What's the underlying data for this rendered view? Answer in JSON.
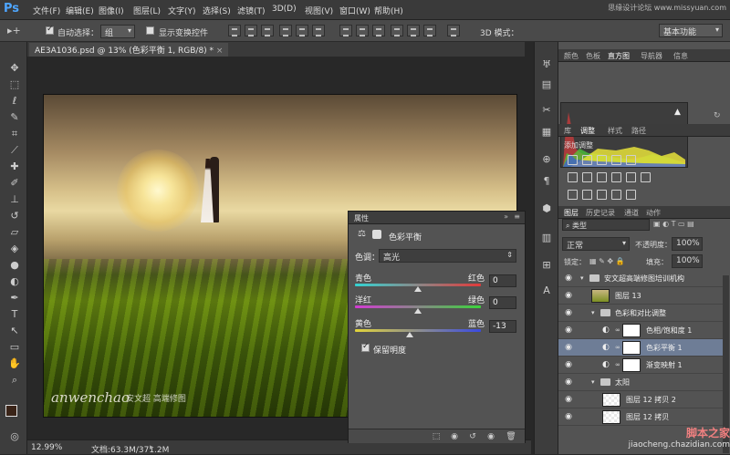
{
  "app": {
    "logo": "Ps"
  },
  "menu": {
    "items": [
      "文件(F)",
      "编辑(E)",
      "图像(I)",
      "图层(L)",
      "文字(Y)",
      "选择(S)",
      "滤镜(T)",
      "3D(D)",
      "视图(V)",
      "窗口(W)",
      "帮助(H)"
    ],
    "watermark": "思缘设计论坛 www.missyuan.com"
  },
  "options": {
    "auto_select_label": "自动选择：",
    "auto_select_value": "组",
    "show_transform_label": "显示变换控件",
    "mode3d_label": "3D 模式：",
    "workspace": "基本功能"
  },
  "document": {
    "tab_title": "AE3A1036.psd @ 13% (色彩平衡 1, RGB/8) *",
    "caption_main": "anwenchao",
    "caption_sub": "安文超 高端修图"
  },
  "status": {
    "zoom": "12.99%",
    "doc_info": "文档:63.3M/371.2M"
  },
  "properties": {
    "title": "属性",
    "adjustment_name": "色彩平衡",
    "tone_label": "色调：",
    "tone_value": "高光",
    "sliders": [
      {
        "left": "青色",
        "right": "红色",
        "value": "0",
        "level": 0,
        "min": -100,
        "max": 100,
        "colors": [
          "#33d4d4",
          "#e23a3a"
        ]
      },
      {
        "left": "洋红",
        "right": "绿色",
        "value": "0",
        "level": 0,
        "min": -100,
        "max": 100,
        "colors": [
          "#d43ad4",
          "#3ad43a"
        ]
      },
      {
        "left": "黄色",
        "right": "蓝色",
        "value": "-13",
        "level": -13,
        "min": -100,
        "max": 100,
        "colors": [
          "#e2d43a",
          "#3a4ae2"
        ]
      }
    ],
    "preserve_luminosity": "保留明度"
  },
  "panels": {
    "top_tabs": [
      "颜色",
      "色板",
      "直方图",
      "导航器",
      "信息"
    ],
    "adj_tabs": [
      "库",
      "调整",
      "样式",
      "路径"
    ],
    "adj_title": "添加调整",
    "layer_tabs": [
      "图层",
      "历史记录",
      "通道",
      "动作"
    ],
    "layer_filter": "类型",
    "blend_mode": "正常",
    "opacity_label": "不透明度：",
    "opacity_value": "100%",
    "lock_label": "锁定：",
    "fill_label": "填充：",
    "fill_value": "100%"
  },
  "layers": [
    {
      "name": "安文超高端修图培训机构",
      "kind": "group",
      "indent": 0
    },
    {
      "name": "图层 13",
      "kind": "photo",
      "indent": 1
    },
    {
      "name": "色彩和对比调整",
      "kind": "group",
      "indent": 1
    },
    {
      "name": "色相/饱和度 1",
      "kind": "adjust",
      "indent": 2
    },
    {
      "name": "色彩平衡 1",
      "kind": "adjust",
      "indent": 2,
      "selected": true
    },
    {
      "name": "渐变映射 1",
      "kind": "adjust",
      "indent": 2
    },
    {
      "name": "太阳",
      "kind": "group",
      "indent": 1
    },
    {
      "name": "图层 12 拷贝 2",
      "kind": "check",
      "indent": 2
    },
    {
      "name": "图层 12 拷贝",
      "kind": "check",
      "indent": 2
    }
  ],
  "watermark_br": {
    "line1": "脚本之家",
    "line2": "jiaocheng.chazidian.com"
  }
}
